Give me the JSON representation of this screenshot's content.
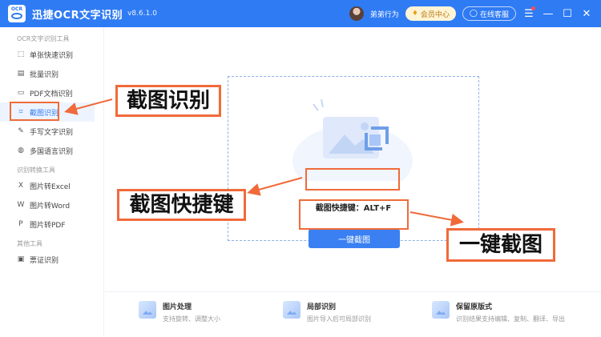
{
  "titlebar": {
    "logo_text": "OCR",
    "title": "迅捷OCR文字识别",
    "version": "v8.6.1.0",
    "username": "弟弟行为",
    "vip_label": "会员中心",
    "service_label": "在线客服"
  },
  "sidebar": {
    "section1": "OCR文字识别工具",
    "section2": "识别转换工具",
    "section3": "其他工具",
    "items": [
      {
        "label": "单张快速识别",
        "icon": "scan-icon"
      },
      {
        "label": "批量识别",
        "icon": "batch-icon"
      },
      {
        "label": "PDF文档识别",
        "icon": "pdf-icon"
      },
      {
        "label": "截图识别",
        "icon": "crop-icon"
      },
      {
        "label": "手写文字识别",
        "icon": "pen-icon"
      },
      {
        "label": "多国语言识别",
        "icon": "globe-icon"
      },
      {
        "label": "图片转Excel",
        "icon": "excel-icon"
      },
      {
        "label": "图片转Word",
        "icon": "word-icon"
      },
      {
        "label": "图片转PDF",
        "icon": "pdf-icon"
      },
      {
        "label": "票证识别",
        "icon": "ticket-icon"
      }
    ]
  },
  "main": {
    "shortcut_text": "截图快捷键：ALT+F",
    "one_click_label": "一键截图",
    "features": [
      {
        "title": "图片处理",
        "desc": "支持旋转、调整大小"
      },
      {
        "title": "局部识别",
        "desc": "图片导入后可局部识别"
      },
      {
        "title": "保留原版式",
        "desc": "识别结果支持编辑、复制、翻译、导出"
      }
    ]
  },
  "annotations": {
    "screenshot_recognition": "截图识别",
    "screenshot_shortcut": "截图快捷键",
    "one_click_capture": "一键截图",
    "color": "#f06a3a"
  }
}
